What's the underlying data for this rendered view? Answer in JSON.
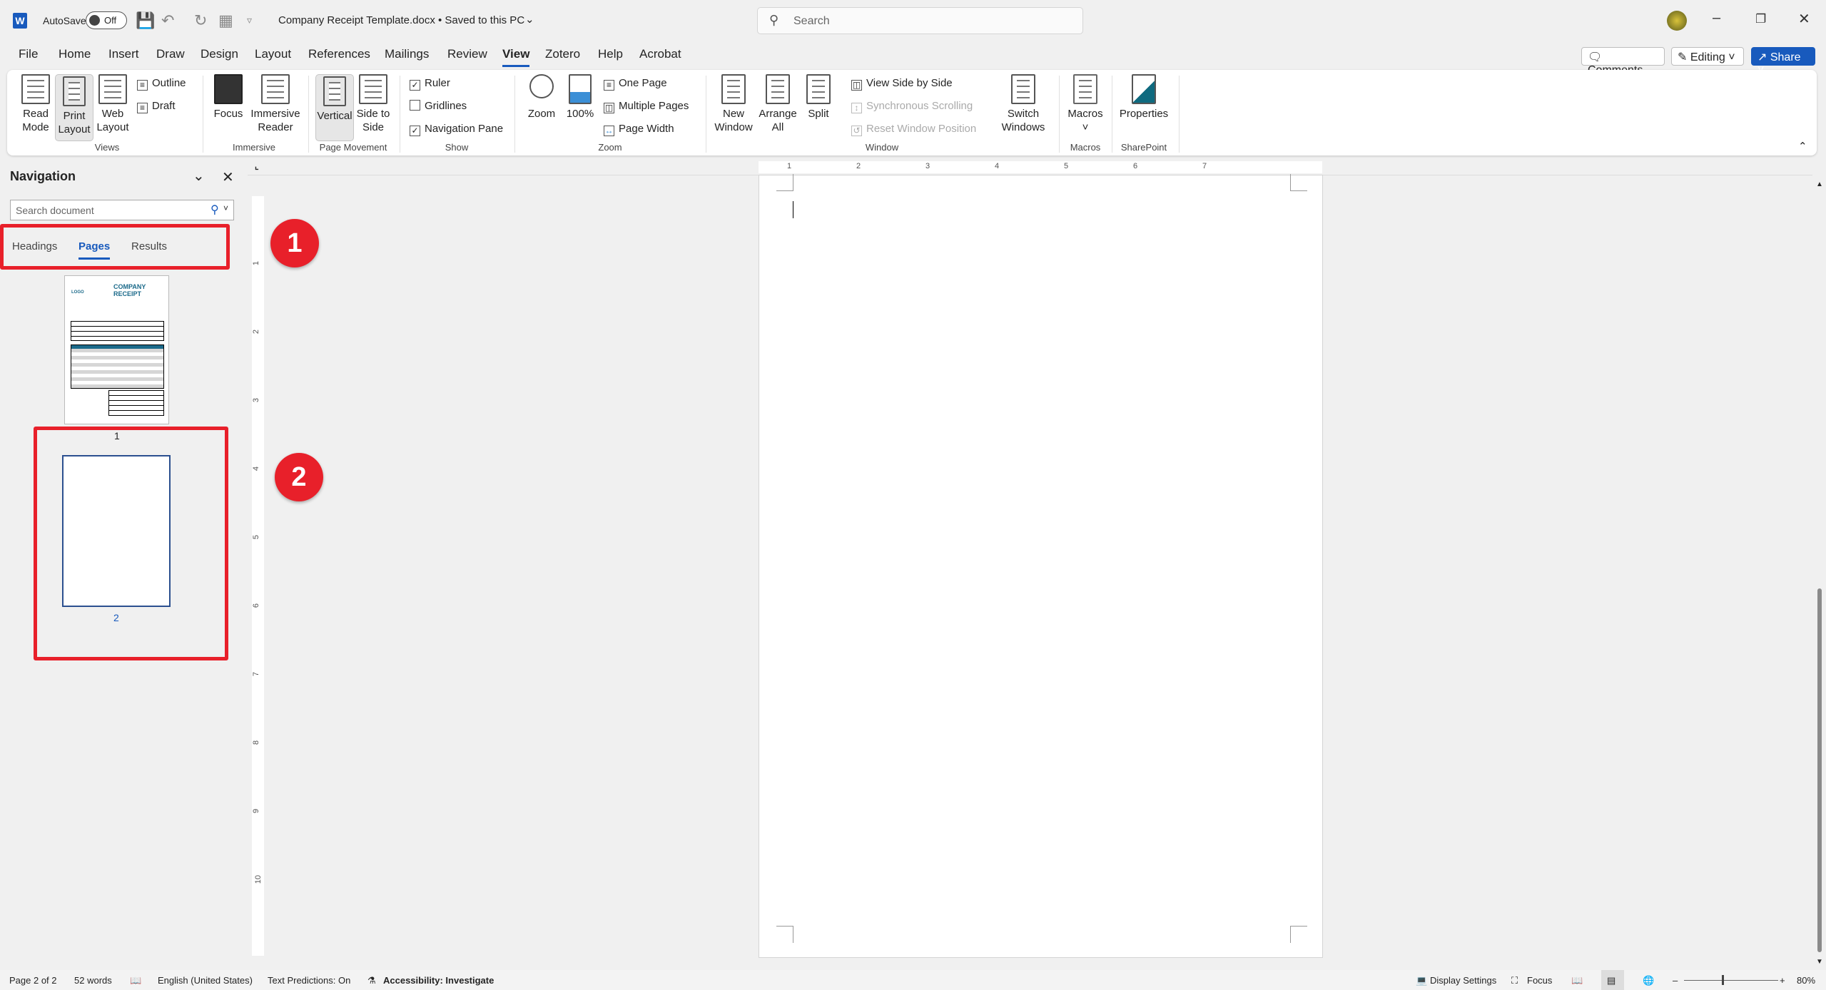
{
  "titlebar": {
    "autosave_label": "AutoSave",
    "autosave_state": "Off",
    "doc_title": "Company Receipt Template.docx • Saved to this PC",
    "search_placeholder": "Search"
  },
  "menu": {
    "items": [
      "File",
      "Home",
      "Insert",
      "Draw",
      "Design",
      "Layout",
      "References",
      "Mailings",
      "Review",
      "View",
      "Zotero",
      "Help",
      "Acrobat"
    ],
    "active": "View"
  },
  "actions": {
    "comments": "Comments",
    "editing": "Editing",
    "share": "Share"
  },
  "ribbon": {
    "views": {
      "label": "Views",
      "read_mode": "Read Mode",
      "print_layout": "Print Layout",
      "web_layout": "Web Layout",
      "outline": "Outline",
      "draft": "Draft"
    },
    "immersive": {
      "label": "Immersive",
      "focus": "Focus",
      "immersive_reader": "Immersive Reader"
    },
    "page_movement": {
      "label": "Page Movement",
      "vertical": "Vertical",
      "side_to_side": "Side to Side"
    },
    "show": {
      "label": "Show",
      "ruler": "Ruler",
      "ruler_checked": true,
      "gridlines": "Gridlines",
      "gridlines_checked": false,
      "navigation_pane": "Navigation Pane",
      "navigation_pane_checked": true
    },
    "zoom": {
      "label": "Zoom",
      "zoom": "Zoom",
      "hundred": "100%",
      "one_page": "One Page",
      "multiple_pages": "Multiple Pages",
      "page_width": "Page Width"
    },
    "window": {
      "label": "Window",
      "new_window": "New Window",
      "arrange_all": "Arrange All",
      "split": "Split",
      "view_side_by_side": "View Side by Side",
      "synchronous_scrolling": "Synchronous Scrolling",
      "reset_window_position": "Reset Window Position",
      "switch_windows": "Switch Windows"
    },
    "macros": {
      "label": "Macros",
      "macros": "Macros"
    },
    "sharepoint": {
      "label": "SharePoint",
      "properties": "Properties"
    }
  },
  "navigation": {
    "title": "Navigation",
    "search_placeholder": "Search document",
    "tabs": [
      "Headings",
      "Pages",
      "Results"
    ],
    "active_tab": "Pages",
    "pages": [
      {
        "number": "1",
        "title": "COMPANY RECEIPT",
        "logo": "LOGO"
      },
      {
        "number": "2"
      }
    ]
  },
  "annotations": [
    {
      "number": "1"
    },
    {
      "number": "2"
    }
  ],
  "ruler": {
    "h_ticks": [
      "1",
      "2",
      "3",
      "4",
      "5",
      "6",
      "7"
    ],
    "v_ticks": [
      "1",
      "2",
      "3",
      "4",
      "5",
      "6",
      "7",
      "8",
      "9",
      "10"
    ]
  },
  "status": {
    "page": "Page 2 of 2",
    "words": "52 words",
    "language": "English (United States)",
    "text_predictions": "Text Predictions: On",
    "accessibility": "Accessibility: Investigate",
    "display_settings": "Display Settings",
    "focus": "Focus",
    "zoom": "80%",
    "zoom_percent": 80
  },
  "colors": {
    "accent": "#185abd",
    "annotation_red": "#e8202a"
  }
}
